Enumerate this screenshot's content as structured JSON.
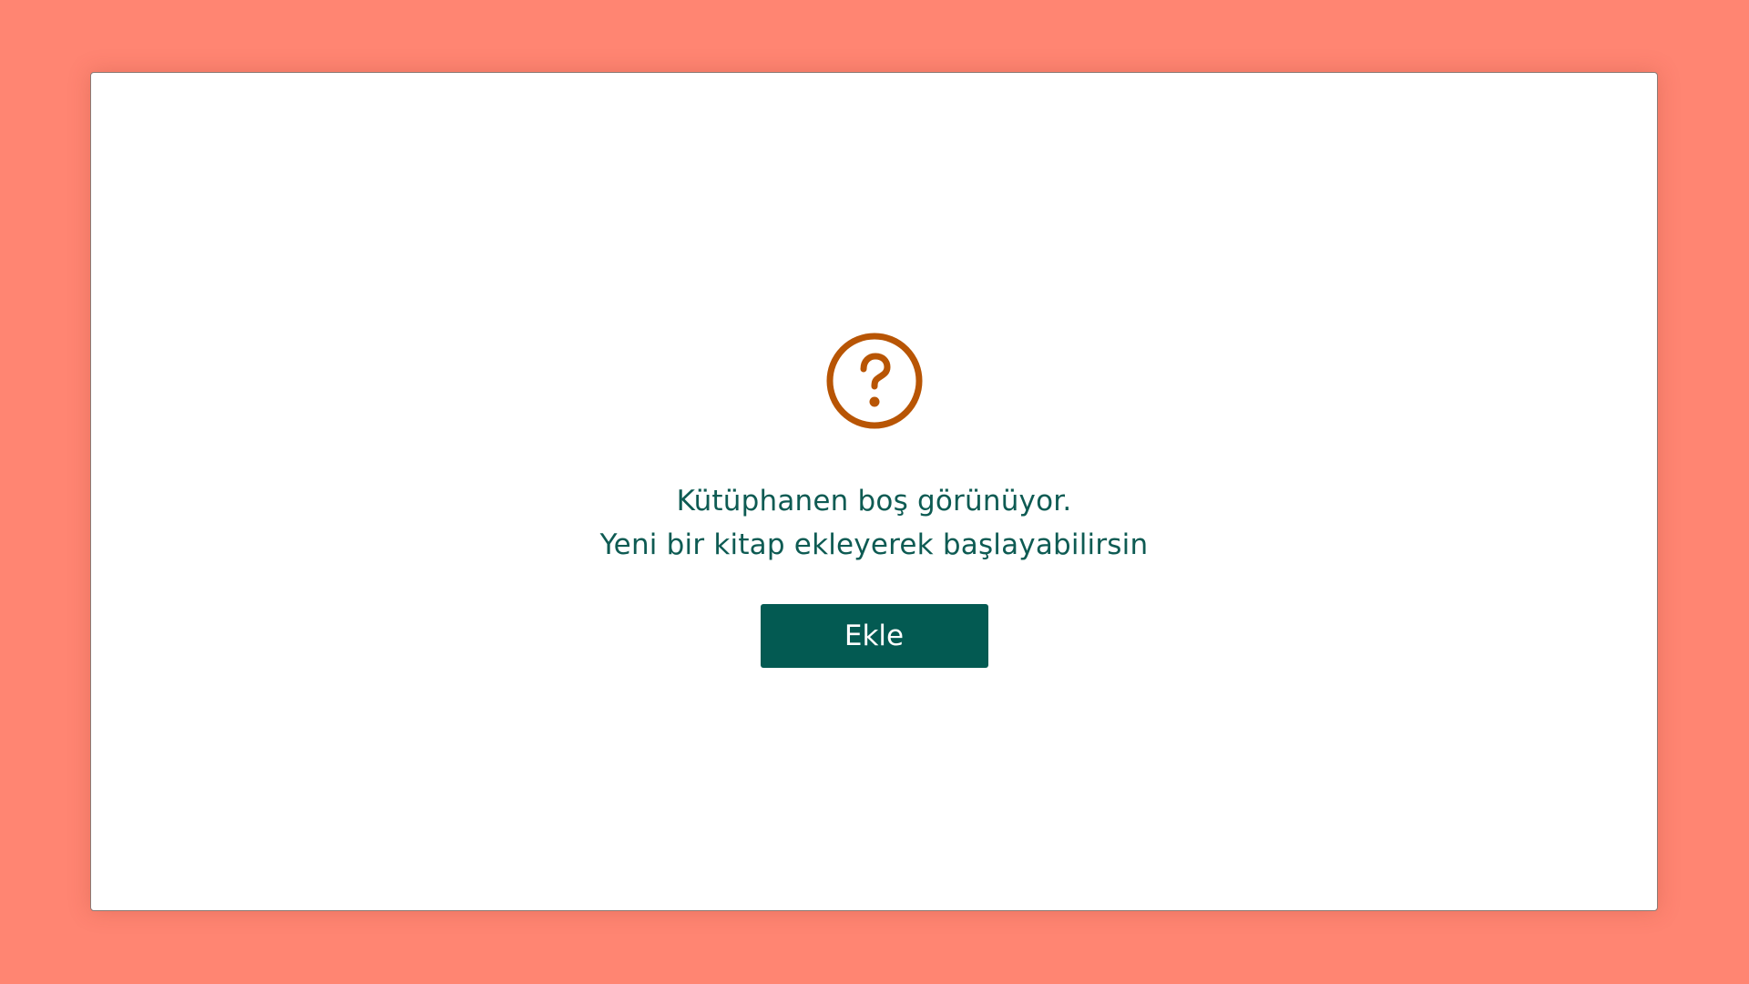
{
  "empty_state": {
    "icon": "question-circle-icon",
    "icon_color": "#B85504",
    "message_line1": "Kütüphanen boş görünüyor.",
    "message_line2": "Yeni bir kitap ekleyerek başlayabilirsin",
    "text_color": "#0E5B53",
    "button_label": "Ekle",
    "button_color": "#035A52"
  },
  "page": {
    "background_color": "#FF8572"
  }
}
